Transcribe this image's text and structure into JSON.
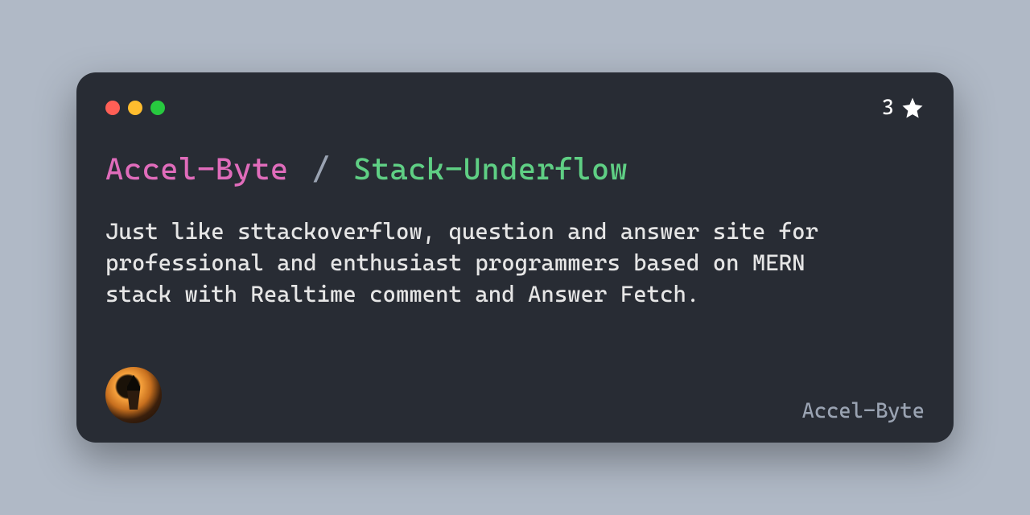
{
  "repo": {
    "owner": "Accel-Byte",
    "separator": "/",
    "name": "Stack-Underflow",
    "description": "Just like sttackoverflow, question and answer site for professional and enthusiast programmers based on MERN stack with Realtime comment and Answer Fetch.",
    "stars": "3"
  },
  "author": "Accel-Byte"
}
